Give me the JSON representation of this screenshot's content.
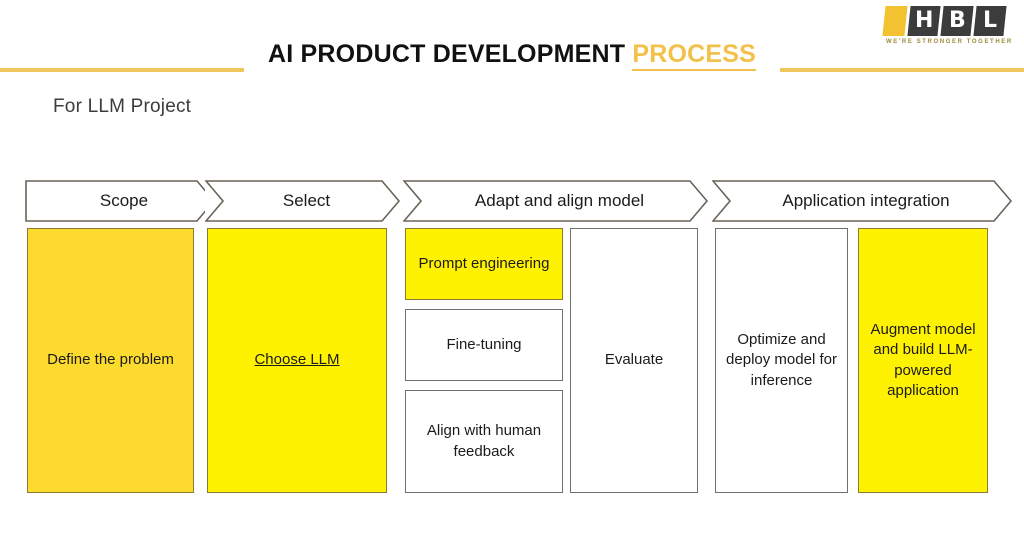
{
  "header": {
    "title_main": "AI PRODUCT DEVELOPMENT ",
    "title_accent": "PROCESS",
    "subtitle": "For LLM Project",
    "rule_color": "#EFC75E"
  },
  "logo": {
    "letters": [
      "H",
      "B",
      "L"
    ],
    "tagline": "WE'RE STRONGER TOGETHER",
    "bar_color": "#F2C230",
    "letter_bg": "#3C3C3C",
    "tagline_color": "#9C8A3A"
  },
  "stages": [
    {
      "label": "Scope"
    },
    {
      "label": "Select"
    },
    {
      "label": "Adapt and align model"
    },
    {
      "label": "Application integration"
    }
  ],
  "boxes": [
    {
      "text": "Define the problem",
      "style": "gold",
      "underline": false
    },
    {
      "text": "Choose LLM",
      "style": "bright",
      "underline": true
    },
    {
      "text": "Prompt engineering",
      "style": "bright",
      "underline": false
    },
    {
      "text": "Fine-tuning",
      "style": "plain",
      "underline": false
    },
    {
      "text": "Align with human feedback",
      "style": "plain",
      "underline": false
    },
    {
      "text": "Evaluate",
      "style": "plain",
      "underline": false
    },
    {
      "text": "Optimize and deploy model for inference",
      "style": "plain",
      "underline": false
    },
    {
      "text": "Augment model and build LLM-powered application",
      "style": "bright",
      "underline": false
    }
  ],
  "colors": {
    "gold": "#FCDA2E",
    "bright_yellow": "#FFF200",
    "accent": "#F3C14A",
    "box_border": "#6b6257"
  }
}
